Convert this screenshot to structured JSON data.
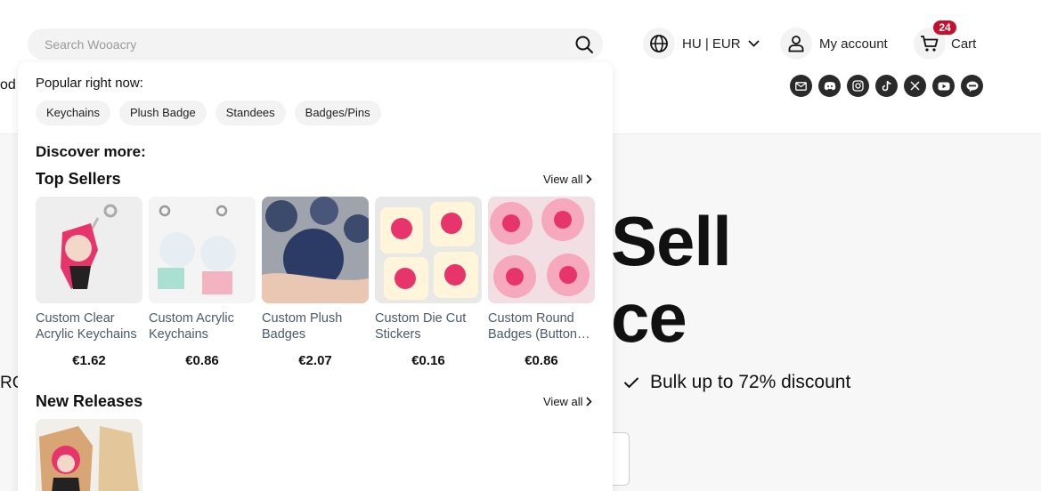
{
  "search": {
    "placeholder": "Search Wooacry"
  },
  "locale": {
    "label": "HU | EUR"
  },
  "account": {
    "label": "My account"
  },
  "cart": {
    "label": "Cart",
    "count": "24"
  },
  "socials": [
    "mail-icon",
    "discord-icon",
    "instagram-icon",
    "tiktok-icon",
    "x-icon",
    "youtube-icon",
    "line-icon"
  ],
  "background": {
    "left_fragment_1": "od",
    "left_fragment_2": "RG",
    "hero_line_1": "Sell",
    "hero_line_2": "ce",
    "feature": "Bulk up to 72% discount"
  },
  "dropdown": {
    "popular_title": "Popular right now:",
    "chips": [
      "Keychains",
      "Plush Badge",
      "Standees",
      "Badges/Pins"
    ],
    "discover_title": "Discover more:",
    "top_sellers": {
      "title": "Top Sellers",
      "view_all": "View all",
      "products": [
        {
          "name": "Custom Clear Acrylic Keychains",
          "price": "€1.62"
        },
        {
          "name": "Custom Acrylic Keychains",
          "price": "€0.86"
        },
        {
          "name": "Custom Plush Badges",
          "price": "€2.07"
        },
        {
          "name": "Custom Die Cut Stickers",
          "price": "€0.16"
        },
        {
          "name": "Custom Round Badges (Button Pins)",
          "price": "€0.86"
        }
      ]
    },
    "new_releases": {
      "title": "New Releases",
      "view_all": "View all"
    }
  },
  "colors": {
    "accent_badge": "#c8102e",
    "search_bg": "#f3f3f3",
    "social_bg": "#2a2a2a"
  }
}
